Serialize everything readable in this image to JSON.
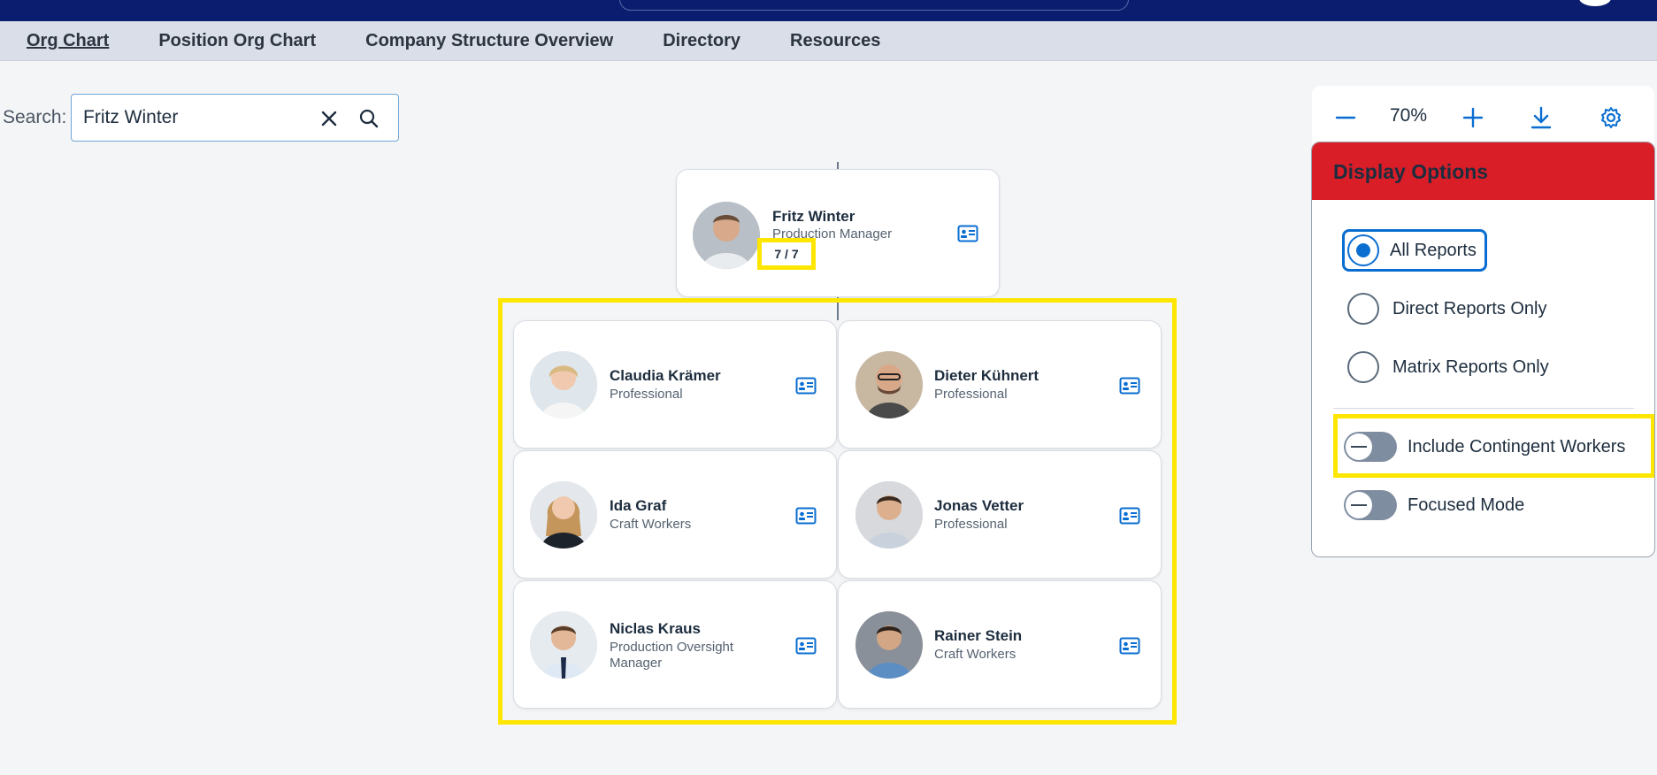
{
  "nav": {
    "tabs": [
      {
        "label": "Org Chart"
      },
      {
        "label": "Position Org Chart"
      },
      {
        "label": "Company Structure Overview"
      },
      {
        "label": "Directory"
      },
      {
        "label": "Resources"
      }
    ]
  },
  "search": {
    "label": "Search:",
    "value": "Fritz Winter"
  },
  "manager": {
    "name": "Fritz Winter",
    "role": "Production Manager",
    "count": "7 / 7"
  },
  "reports": [
    {
      "name": "Claudia Krämer",
      "role": "Professional"
    },
    {
      "name": "Dieter Kühnert",
      "role": "Professional"
    },
    {
      "name": "Ida Graf",
      "role": "Craft Workers"
    },
    {
      "name": "Jonas Vetter",
      "role": "Professional"
    },
    {
      "name": "Niclas Kraus",
      "role": "Production Oversight Manager"
    },
    {
      "name": "Rainer Stein",
      "role": "Craft Workers"
    }
  ],
  "toolbar": {
    "zoom": "70%"
  },
  "display_options": {
    "title": "Display Options",
    "radios": [
      {
        "label": "All Reports",
        "checked": true
      },
      {
        "label": "Direct Reports Only",
        "checked": false
      },
      {
        "label": "Matrix Reports Only",
        "checked": false
      }
    ],
    "toggles": [
      {
        "label": "Include Contingent Workers",
        "on": false
      },
      {
        "label": "Focused Mode",
        "on": false
      }
    ]
  },
  "colors": {
    "shellbar": "#0a1d6e",
    "accent": "#0a6ed1",
    "panel_header": "#da1e28",
    "highlight": "#ffe600"
  }
}
